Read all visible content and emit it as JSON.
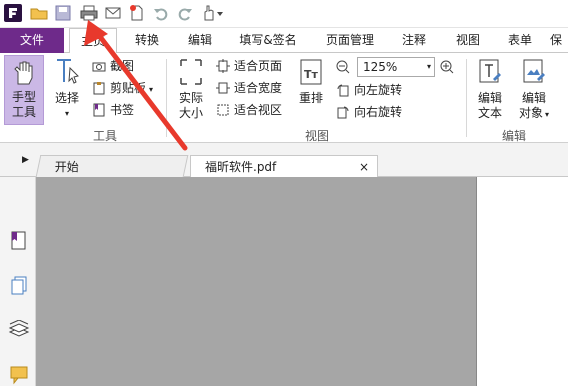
{
  "tabs": [
    "文件",
    "主页",
    "转换",
    "编辑",
    "填写&签名",
    "页面管理",
    "注释",
    "视图",
    "表单",
    "保"
  ],
  "home": {
    "hand_tool": [
      "手型",
      "工具"
    ],
    "select": "选择",
    "screenshot": "截图",
    "clipboard": "剪贴板",
    "bookmark": "书签",
    "tools_group": "工具",
    "actual_size": [
      "实际",
      "大小"
    ],
    "fit_page": "适合页面",
    "fit_width": "适合宽度",
    "fit_view": "适合视区",
    "reflow": "重排",
    "zoom": "125%",
    "rotate_left": "向左旋转",
    "rotate_right": "向右旋转",
    "view_group": "视图",
    "edit_text": [
      "编辑",
      "文本"
    ],
    "edit_object": [
      "编辑",
      "对象"
    ],
    "edit_group": "编辑"
  },
  "doc_tabs": {
    "start": "开始",
    "file": "福昕软件.pdf",
    "close": "×"
  },
  "colors": {
    "file_tab": "#6e2a8a",
    "active_tool": "#cbb8e6",
    "canvas": "#a6a6a6",
    "annotation_arrow": "#e8392c"
  }
}
